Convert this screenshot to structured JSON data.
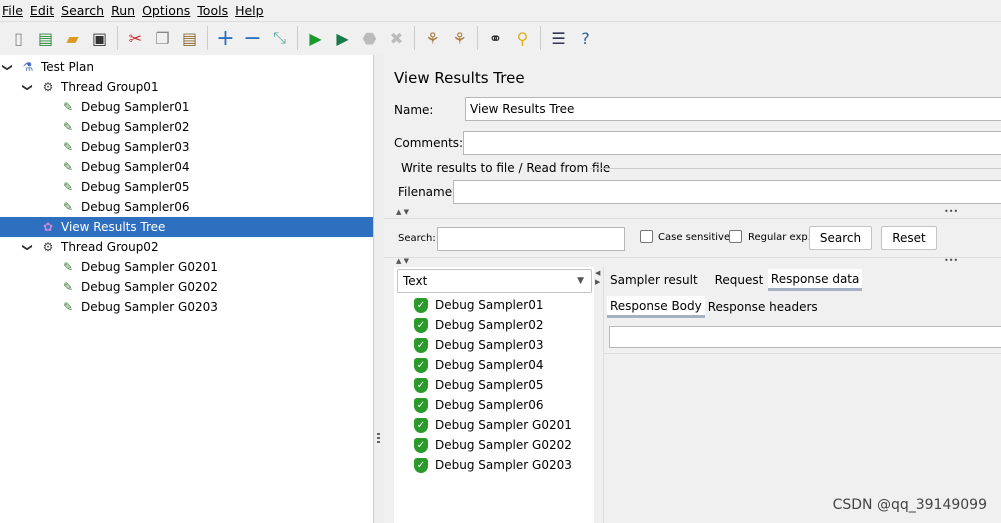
{
  "menu": [
    "File",
    "Edit",
    "Search",
    "Run",
    "Options",
    "Tools",
    "Help"
  ],
  "toolbar": [
    {
      "icon": "new-icon",
      "g": "▯",
      "c": "#888"
    },
    {
      "icon": "templates-icon",
      "g": "▤",
      "c": "#2a8a3a"
    },
    {
      "icon": "open-icon",
      "g": "▰",
      "c": "#d99a20"
    },
    {
      "icon": "save-icon",
      "g": "▣",
      "c": "#333"
    },
    "sep",
    {
      "icon": "cut-icon",
      "g": "✂",
      "c": "#c22"
    },
    {
      "icon": "copy-icon",
      "g": "❐",
      "c": "#888"
    },
    {
      "icon": "paste-icon",
      "g": "▤",
      "c": "#8a6a30"
    },
    "sep",
    {
      "icon": "expand-icon",
      "g": "+",
      "c": "#2b6fc0"
    },
    {
      "icon": "collapse-icon",
      "g": "−",
      "c": "#2b6fc0"
    },
    {
      "icon": "toggle-icon",
      "g": "⤡",
      "c": "#5a9"
    },
    "sep",
    {
      "icon": "start-icon",
      "g": "▶",
      "c": "#1a9a2a"
    },
    {
      "icon": "start-no-pauses-icon",
      "g": "▶",
      "c": "#1a7a4a"
    },
    {
      "icon": "stop-icon",
      "g": "⬣",
      "c": "#bbb"
    },
    {
      "icon": "shutdown-icon",
      "g": "✖",
      "c": "#bbb"
    },
    "sep",
    {
      "icon": "clear-icon",
      "g": "⚘",
      "c": "#a87a40"
    },
    {
      "icon": "clear-all-icon",
      "g": "⚘",
      "c": "#a87a40"
    },
    "sep",
    {
      "icon": "search-icon",
      "g": "⚭",
      "c": "#222"
    },
    {
      "icon": "reset-search-icon",
      "g": "⚲",
      "c": "#e0b020"
    },
    "sep",
    {
      "icon": "function-helper-icon",
      "g": "☰",
      "c": "#335"
    },
    {
      "icon": "help-icon",
      "g": "?",
      "c": "#2b5fa0"
    }
  ],
  "tree": [
    {
      "label": "Test Plan",
      "level": 0,
      "icon": "test-plan-icon",
      "expanded": true
    },
    {
      "label": "Thread Group01",
      "level": 1,
      "icon": "gear-icon",
      "expanded": true
    },
    {
      "label": "Debug Sampler01",
      "level": 2,
      "icon": "dropper-icon"
    },
    {
      "label": "Debug Sampler02",
      "level": 2,
      "icon": "dropper-icon"
    },
    {
      "label": "Debug Sampler03",
      "level": 2,
      "icon": "dropper-icon"
    },
    {
      "label": "Debug Sampler04",
      "level": 2,
      "icon": "dropper-icon"
    },
    {
      "label": "Debug Sampler05",
      "level": 2,
      "icon": "dropper-icon"
    },
    {
      "label": "Debug Sampler06",
      "level": 2,
      "icon": "dropper-icon"
    },
    {
      "label": "View Results Tree",
      "level": 1,
      "icon": "listener-icon",
      "selected": true
    },
    {
      "label": "Thread Group02",
      "level": 1,
      "icon": "gear-icon",
      "expanded": true
    },
    {
      "label": "Debug Sampler G0201",
      "level": 2,
      "icon": "dropper-icon"
    },
    {
      "label": "Debug Sampler G0202",
      "level": 2,
      "icon": "dropper-icon"
    },
    {
      "label": "Debug Sampler G0203",
      "level": 2,
      "icon": "dropper-icon"
    }
  ],
  "panel": {
    "title": "View Results Tree",
    "name_label": "Name:",
    "name_value": "View Results Tree",
    "comments_label": "Comments:",
    "comments_value": "",
    "file_group": "Write results to file / Read from file",
    "filename_label": "Filename",
    "filename_value": "",
    "search_label": "Search:",
    "search_value": "",
    "case_sensitive": "Case sensitive",
    "regular_exp": "Regular exp.",
    "search_button": "Search",
    "reset_button": "Reset",
    "renderer": "Text",
    "results": [
      "Debug Sampler01",
      "Debug Sampler02",
      "Debug Sampler03",
      "Debug Sampler04",
      "Debug Sampler05",
      "Debug Sampler06",
      "Debug Sampler G0201",
      "Debug Sampler G0202",
      "Debug Sampler G0203"
    ],
    "tabs": [
      "Sampler result",
      "Request",
      "Response data"
    ],
    "active_tab": "Response data",
    "subtabs": [
      "Response Body",
      "Response headers"
    ],
    "active_subtab": "Response Body",
    "response_search": ""
  },
  "watermark": "CSDN @qq_39149099"
}
